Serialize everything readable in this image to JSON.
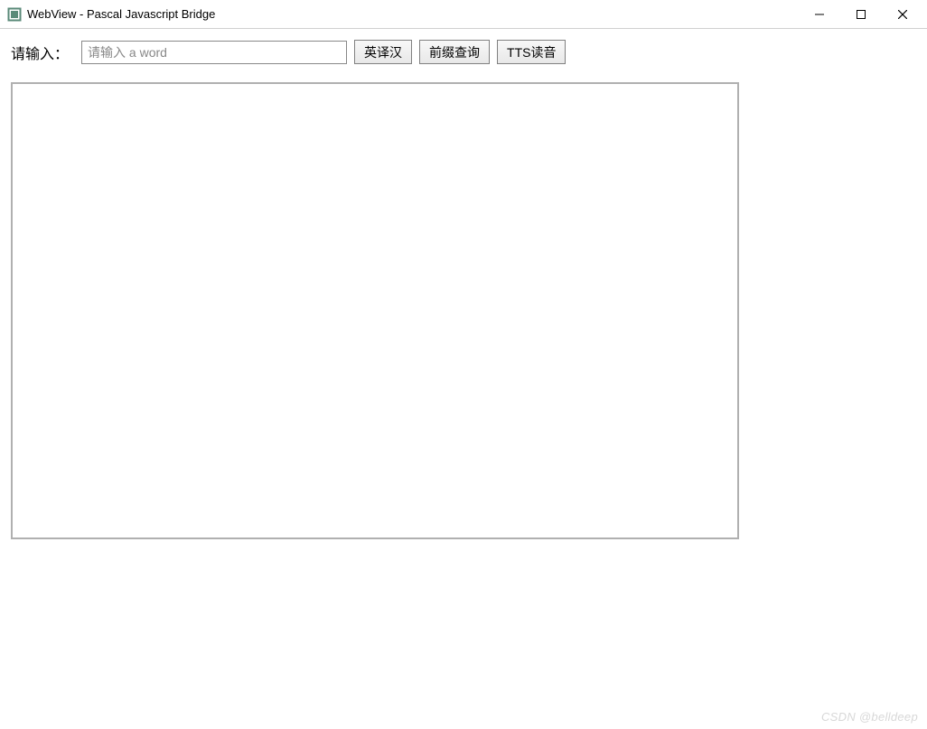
{
  "window": {
    "title": "WebView - Pascal Javascript Bridge"
  },
  "form": {
    "label": "请输入：",
    "placeholder": "请输入 a word",
    "value": ""
  },
  "buttons": {
    "translate": "英译汉",
    "prefix_query": "前缀查询",
    "tts": "TTS读音"
  },
  "watermark": "CSDN @belldeep"
}
